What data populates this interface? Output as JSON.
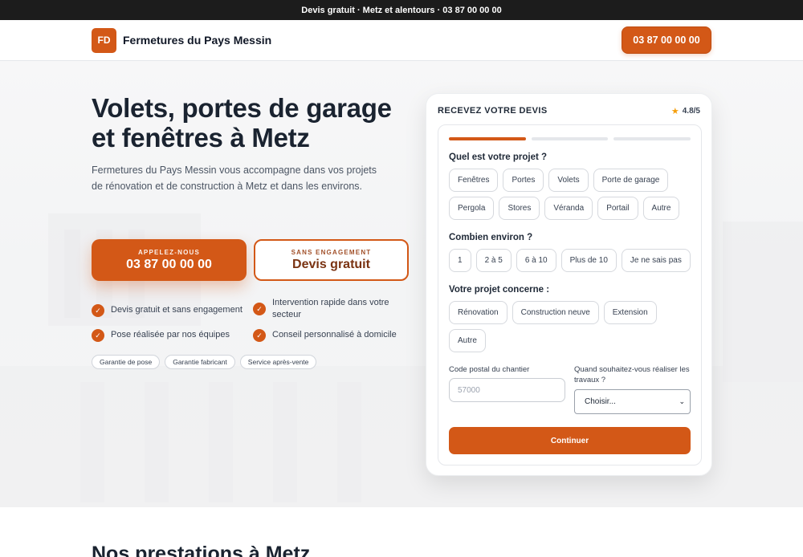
{
  "topbar": {
    "text": "Devis gratuit · Metz et alentours · 03 87 00 00 00"
  },
  "header": {
    "logo_initials": "FD",
    "brand_name": "Fermetures du Pays Messin",
    "phone_button": "03 87 00 00 00"
  },
  "hero": {
    "title_line1": "Volets, portes de garage",
    "title_line2": "et fenêtres à Metz",
    "intro": "Fermetures du Pays Messin vous accompagne dans vos projets de rénovation et de construction à Metz et dans les environs.",
    "cta_call": {
      "small": "APPELEZ-NOUS",
      "big": "03 87 00 00 00"
    },
    "cta_devis": {
      "small": "SANS ENGAGEMENT",
      "big": "Devis gratuit"
    },
    "features": [
      "Devis gratuit et sans engagement",
      "Intervention rapide dans votre secteur",
      "Pose réalisée par nos équipes",
      "Conseil personnalisé à domicile"
    ],
    "badges": [
      "Garantie de pose",
      "Garantie fabricant",
      "Service après-vente"
    ]
  },
  "form": {
    "title": "RECEVEZ VOTRE DEVIS",
    "rating": "4.8/5",
    "progress_step": 1,
    "progress_total": 3,
    "q1": {
      "label": "Quel est votre projet ?",
      "options": [
        "Fenêtres",
        "Portes",
        "Volets",
        "Porte de garage",
        "Pergola",
        "Stores",
        "Véranda",
        "Portail",
        "Autre"
      ]
    },
    "q2": {
      "label": "Combien environ ?",
      "options": [
        "1",
        "2 à 5",
        "6 à 10",
        "Plus de 10",
        "Je ne sais pas"
      ]
    },
    "q3": {
      "label": "Votre projet concerne :",
      "options": [
        "Rénovation",
        "Construction neuve",
        "Extension",
        "Autre"
      ]
    },
    "postal": {
      "label": "Code postal du chantier",
      "placeholder": "57000"
    },
    "when": {
      "label": "Quand souhaitez-vous réaliser les travaux ?",
      "selected": "Choisir..."
    },
    "submit": "Continuer"
  },
  "section": {
    "title": "Nos prestations à Metz"
  },
  "colors": {
    "accent": "#d35817",
    "dark": "#1c1c1c",
    "text": "#1a2330"
  }
}
